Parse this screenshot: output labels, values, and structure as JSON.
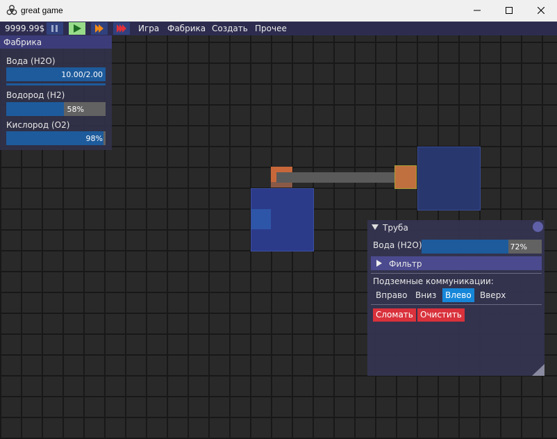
{
  "window": {
    "title": "great game",
    "icon": "biohazard-icon"
  },
  "toolbar": {
    "money": "9999.99$",
    "buttons": [
      "pause-icon",
      "play-icon",
      "fast-forward-icon",
      "fastest-forward-icon"
    ],
    "menu": [
      "Игра",
      "Фабрика",
      "Создать",
      "Прочее"
    ]
  },
  "factory_panel": {
    "title": "Фабрика",
    "resources": [
      {
        "label": "Вода (H2O)",
        "text": "10.00/2.00",
        "fill": 1.0
      },
      {
        "label": "Водород (H2)",
        "text": "58%",
        "fill": 0.58
      },
      {
        "label": "Кислород (O2)",
        "text": "98%",
        "fill": 0.98
      }
    ]
  },
  "pipe_panel": {
    "title": "Труба",
    "resource_label": "Вода (H2O)",
    "resource_text": "72%",
    "resource_fill": 0.72,
    "filter_label": "Фильтр",
    "underground_label": "Подземные коммуникации:",
    "directions": [
      "Вправо",
      "Вниз",
      "Влево",
      "Вверх"
    ],
    "active_direction": "Влево",
    "break_label": "Сломать",
    "clear_label": "Очистить"
  },
  "colors": {
    "menubar": "#2d2c4f",
    "panel_header": "#3d3c7a",
    "bar_fill": "#1d5b9c",
    "active_tab": "#1686d9",
    "danger": "#d9323c",
    "building": "#2b3b8a",
    "pipe": "#5a5a5a",
    "pipe_end": "#c8683a"
  }
}
